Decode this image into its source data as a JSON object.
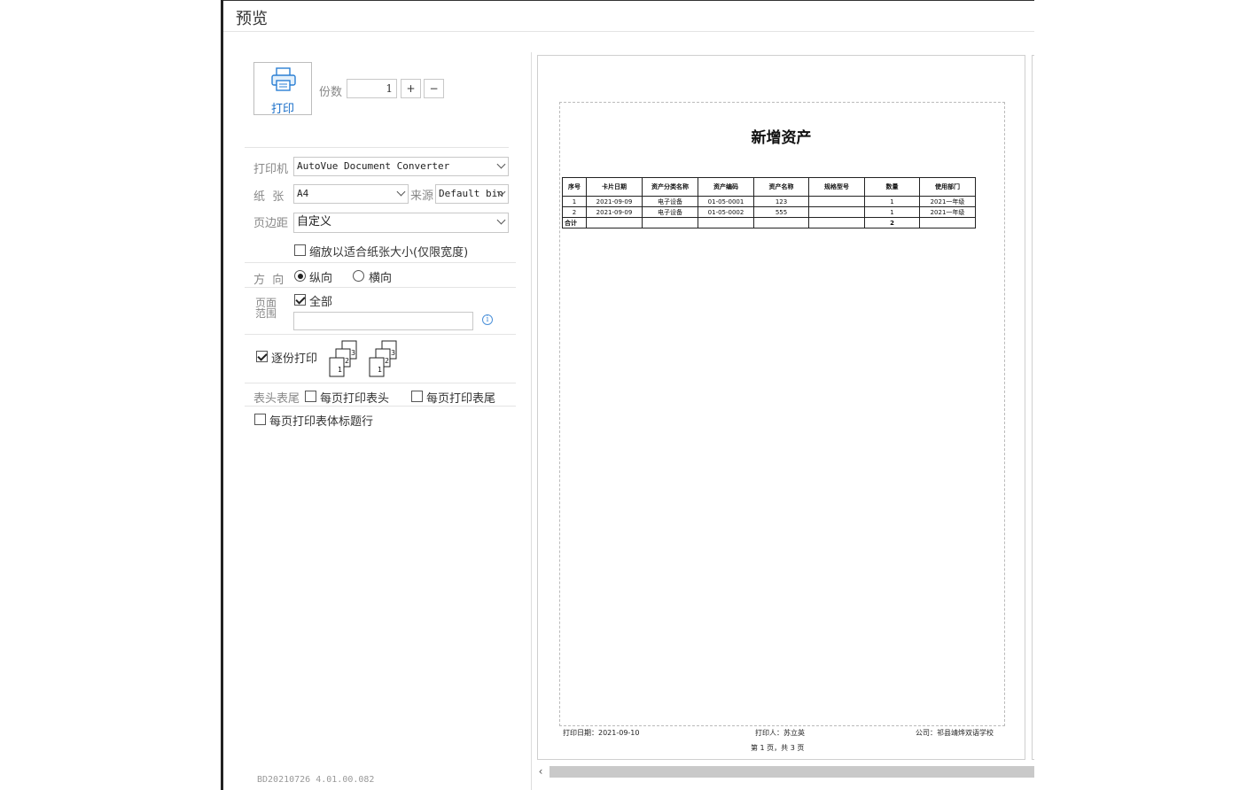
{
  "window": {
    "title": "预览"
  },
  "print_button": {
    "label": "打印"
  },
  "copies": {
    "label": "份数",
    "value": "1",
    "plus": "+",
    "minus": "−"
  },
  "printer": {
    "label": "打印机",
    "value": "AutoVue Document Converter"
  },
  "paper": {
    "label": "纸  张",
    "value": "A4",
    "source_label": "来源",
    "source_value": "Default bin"
  },
  "margin": {
    "label": "页边距",
    "value": "自定义"
  },
  "scale_to_fit": {
    "label": "缩放以适合纸张大小(仅限宽度)",
    "checked": false
  },
  "orientation": {
    "label": "方  向",
    "portrait": "纵向",
    "landscape": "横向",
    "selected": "portrait"
  },
  "page_range": {
    "label": "页面范围",
    "all_label": "全部",
    "all_checked": true,
    "value": ""
  },
  "collate": {
    "label": "逐份打印",
    "checked": true
  },
  "header_footer": {
    "label": "表头表尾",
    "each_header": "每页打印表头",
    "each_footer": "每页打印表尾"
  },
  "each_body_title": {
    "label": "每页打印表体标题行"
  },
  "version": "BD20210726 4.01.00.082",
  "preview": {
    "doc_title": "新增资产",
    "columns": [
      "序号",
      "卡片日期",
      "资产分类名称",
      "资产编码",
      "资产名称",
      "规格型号",
      "数量",
      "使用部门"
    ],
    "rows": [
      [
        "1",
        "2021-09-09",
        "电子设备",
        "01-05-0001",
        "123",
        "",
        "1",
        "2021一年级"
      ],
      [
        "2",
        "2021-09-09",
        "电子设备",
        "01-05-0002",
        "555",
        "",
        "1",
        "2021一年级"
      ]
    ],
    "total_row": [
      "合计",
      "",
      "",
      "",
      "",
      "",
      "2",
      ""
    ],
    "print_date": "打印日期：2021-09-10",
    "printer_person": "打印人：苏立英",
    "company": "公司：祁县靖烨双语学校",
    "page_info": "第 1 页，共 3 页"
  }
}
